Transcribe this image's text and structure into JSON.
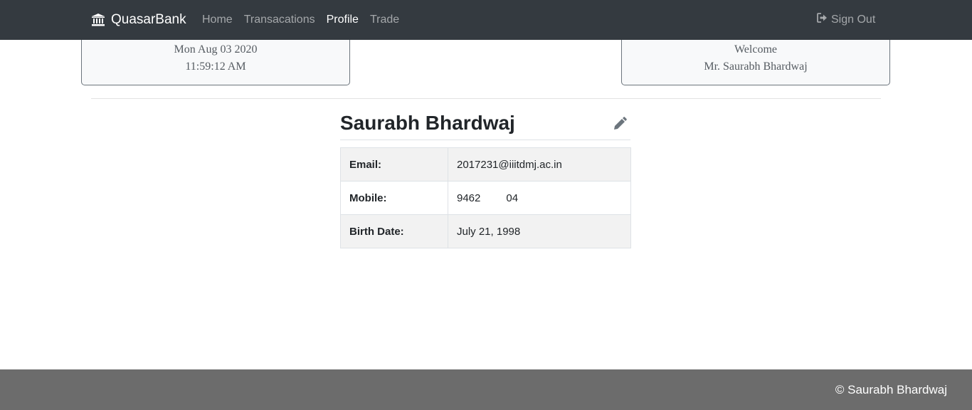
{
  "navbar": {
    "brand": "QuasarBank",
    "links": [
      {
        "label": "Home",
        "active": false
      },
      {
        "label": "Transacations",
        "active": false
      },
      {
        "label": "Profile",
        "active": true
      },
      {
        "label": "Trade",
        "active": false
      }
    ],
    "signout_label": "Sign Out",
    "background": "#343a40"
  },
  "datetime_card": {
    "date": "Mon Aug 03 2020",
    "time": "11:59:12 AM"
  },
  "welcome_card": {
    "greeting": "Welcome",
    "name": "Mr. Saurabh Bhardwaj"
  },
  "profile": {
    "name": "Saurabh Bhardwaj",
    "edit_icon": "pencil-icon",
    "rows": [
      {
        "label": "Email:",
        "value": "2017231@iiitdmj.ac.in"
      },
      {
        "label": "Mobile:",
        "value_start": "9462",
        "value_end": "04"
      },
      {
        "label": "Birth Date:",
        "value": "July 21, 1998"
      }
    ]
  },
  "footer": {
    "text": "© Saurabh Bhardwaj",
    "background": "#6c6c6c"
  }
}
